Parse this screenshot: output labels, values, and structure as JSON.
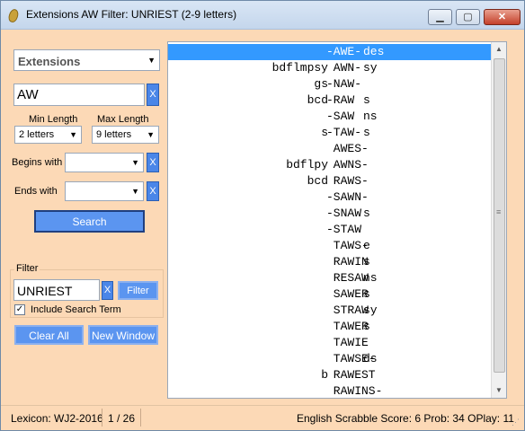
{
  "window": {
    "title": "Extensions AW Filter: UNRIEST (2-9 letters)",
    "min_label": "▁",
    "max_label": "▢",
    "close_label": "✕"
  },
  "left": {
    "search_type": "Extensions",
    "search_value": "AW",
    "clear_x": "X",
    "min_length_label": "Min Length",
    "max_length_label": "Max Length",
    "min_length": "2 letters",
    "max_length": "9 letters",
    "begins_with_label": "Begins with",
    "ends_with_label": "Ends with",
    "search_button": "Search",
    "filter_group_label": "Filter",
    "filter_value": "UNRIEST",
    "filter_button": "Filter",
    "include_search_term": "Include Search Term",
    "include_checked": "✓",
    "clear_all": "Clear All",
    "new_window": "New Window"
  },
  "results": [
    {
      "pre": "",
      "word": "-AWE-",
      "post": "des",
      "selected": true
    },
    {
      "pre": "bdflmpsy",
      "word": " AWN-",
      "post": "sy",
      "selected": false
    },
    {
      "pre": "gs",
      "word": "-NAW-",
      "post": "",
      "selected": false
    },
    {
      "pre": "bcd",
      "word": "-RAW",
      "post": "s",
      "selected": false
    },
    {
      "pre": "",
      "word": "-SAW",
      "post": "ns",
      "selected": false
    },
    {
      "pre": "s",
      "word": "-TAW-",
      "post": "s",
      "selected": false
    },
    {
      "pre": "",
      "word": " AWES-",
      "post": "",
      "selected": false
    },
    {
      "pre": "bdflpy",
      "word": " AWNS-",
      "post": "",
      "selected": false
    },
    {
      "pre": "bcd",
      "word": " RAWS-",
      "post": "",
      "selected": false
    },
    {
      "pre": "",
      "word": "-SAWN-",
      "post": "",
      "selected": false
    },
    {
      "pre": "",
      "word": "-SNAW",
      "post": "s",
      "selected": false
    },
    {
      "pre": "",
      "word": "-STAW",
      "post": "",
      "selected": false
    },
    {
      "pre": "",
      "word": " TAWS-",
      "post": "e",
      "selected": false
    },
    {
      "pre": "",
      "word": " RAWIN",
      "post": "s",
      "selected": false
    },
    {
      "pre": "",
      "word": " RESAW",
      "post": "ns",
      "selected": false
    },
    {
      "pre": "",
      "word": " SAWER",
      "post": "s",
      "selected": false
    },
    {
      "pre": "",
      "word": " STRAW",
      "post": "sy",
      "selected": false
    },
    {
      "pre": "",
      "word": " TAWER",
      "post": "s",
      "selected": false
    },
    {
      "pre": "",
      "word": " TAWIE",
      "post": "",
      "selected": false
    },
    {
      "pre": "",
      "word": " TAWSE-",
      "post": "ds",
      "selected": false
    },
    {
      "pre": "b",
      "word": " RAWEST",
      "post": "",
      "selected": false
    },
    {
      "pre": "",
      "word": " RAWINS-",
      "post": "",
      "selected": false
    }
  ],
  "status": {
    "lexicon": "Lexicon: WJ2-2016",
    "position": "1 / 26",
    "score": "English Scrabble Score: 6 Prob: 34 OPlay: 11"
  },
  "colors": {
    "panel_bg": "#fcd9b6",
    "selection": "#3399ff",
    "button_blue": "#5b95f0"
  }
}
